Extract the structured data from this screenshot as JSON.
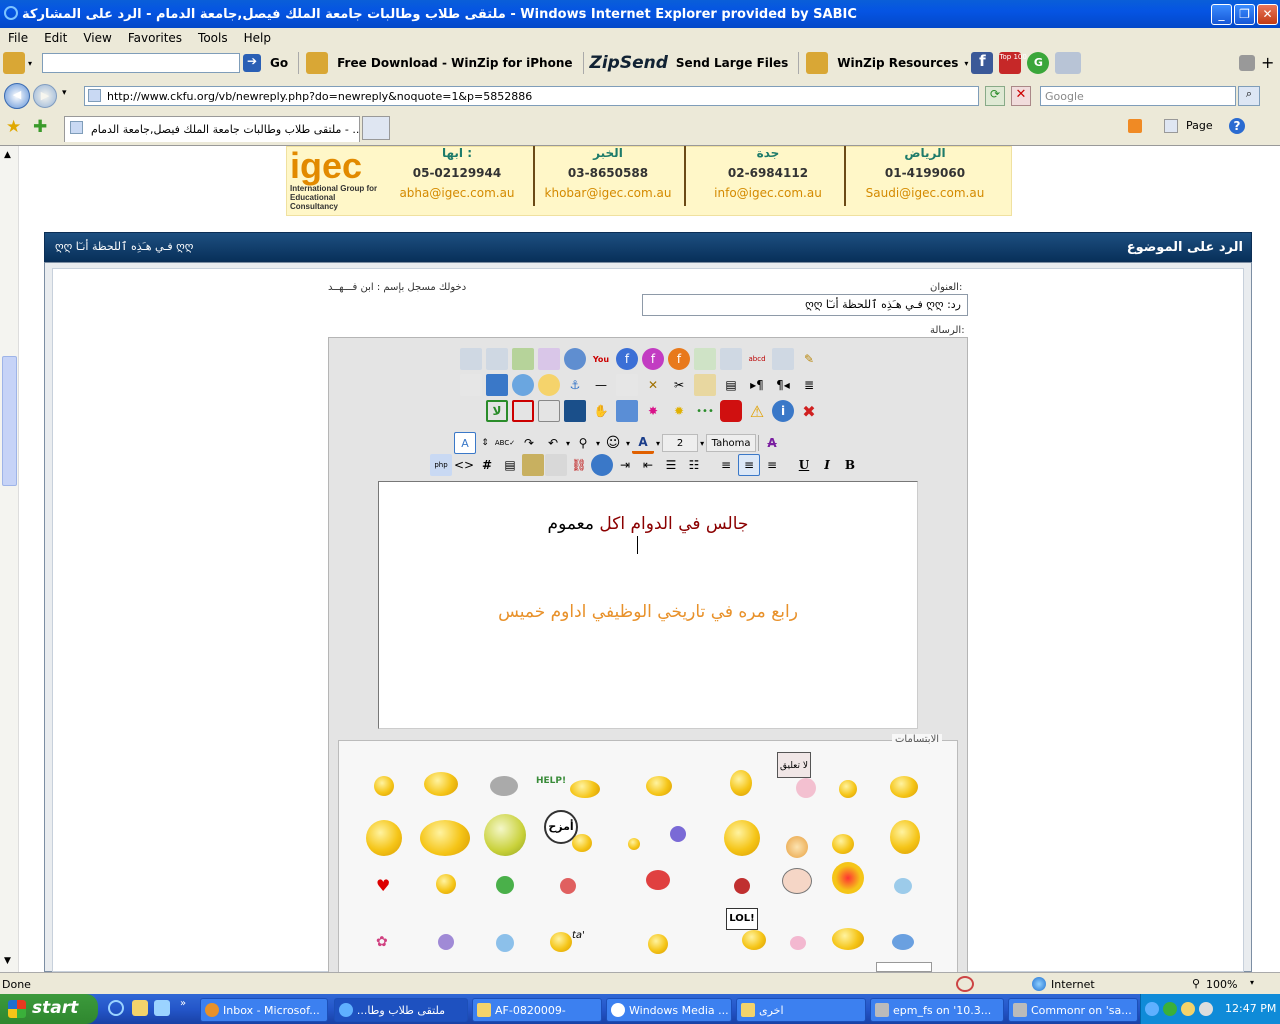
{
  "window": {
    "title": "ملتقى طلاب وطالبات جامعة الملك فيصل,جامعة الدمام - الرد على المشاركة - Windows Internet Explorer provided by SABIC",
    "minimize": "_",
    "maximize": "❐",
    "close": "✕"
  },
  "menu": [
    "File",
    "Edit",
    "View",
    "Favorites",
    "Tools",
    "Help"
  ],
  "toolbar": {
    "go": "Go",
    "winzip_iphone": "Free Download - WinZip for iPhone",
    "zipsend_logo": "ZipSend",
    "send_large": "Send Large Files",
    "winzip_resources": "WinZip Resources",
    "top100": "Top 100"
  },
  "address": {
    "url": "http://www.ckfu.org/vb/newreply.php?do=newreply&noquote=1&p=5852886",
    "search_placeholder": "Google"
  },
  "tab": {
    "title": "ملتقى طلاب وطالبات جامعة الملك فيصل,جامعة الدمام - ...",
    "page_menu": "Page"
  },
  "banner": {
    "logo": "igec",
    "logo_sub": "International Group for Educational Consultancy",
    "cols": [
      {
        "city": "ابها :",
        "phone": "05-02129944",
        "email": "abha@igec.com.au"
      },
      {
        "city": "الخبر",
        "phone": "03-8650588",
        "email": "khobar@igec.com.au"
      },
      {
        "city": "جدة",
        "phone": "02-6984112",
        "email": "info@igec.com.au"
      },
      {
        "city": "الرياض",
        "phone": "01-4199060",
        "email": "Saudi@igec.com.au"
      }
    ]
  },
  "panel": {
    "title": "الرد على الموضوع",
    "subtitle": "ღღ فـي هـَذِه ٱللحظة أنـٓا ღღ",
    "logged_in": "دخولك مسجل بإسم : ابن فـــهــد",
    "subject_label": "العنوان:",
    "subject_value": "رد: ღღ فـي هـَذِه ٱللحظة أنـٓا ღღ",
    "message_label": "الرسالة:"
  },
  "editor": {
    "font_name": "Tahoma",
    "font_size": "2",
    "line1_red": "جالس في الدوام اكل",
    "line1_black": "معموم",
    "line2": "رابع مره في تاريخي الوظيفي اداوم خميس",
    "colors": {
      "red": "#8b0000",
      "orange": "#e8912a"
    }
  },
  "smilies": {
    "label": "الابتسامات",
    "help_text": "HELP!",
    "no_comment": "لا تعليق",
    "joke": "أمزح",
    "lol": "LOL!"
  },
  "status": {
    "left": "Done",
    "zone": "Internet",
    "zoom": "100%"
  },
  "taskbar": {
    "start": "start",
    "items": [
      {
        "label": "Inbox - Microsof..."
      },
      {
        "label": "ملتقى طلاب وطا...",
        "active": true
      },
      {
        "label": "AF-0820009-"
      },
      {
        "label": "Windows Media ..."
      },
      {
        "label": "اخرى"
      },
      {
        "label": "epm_fs on '10.3..."
      },
      {
        "label": "Commonr on 'sa..."
      }
    ],
    "clock": "12:47 PM"
  }
}
